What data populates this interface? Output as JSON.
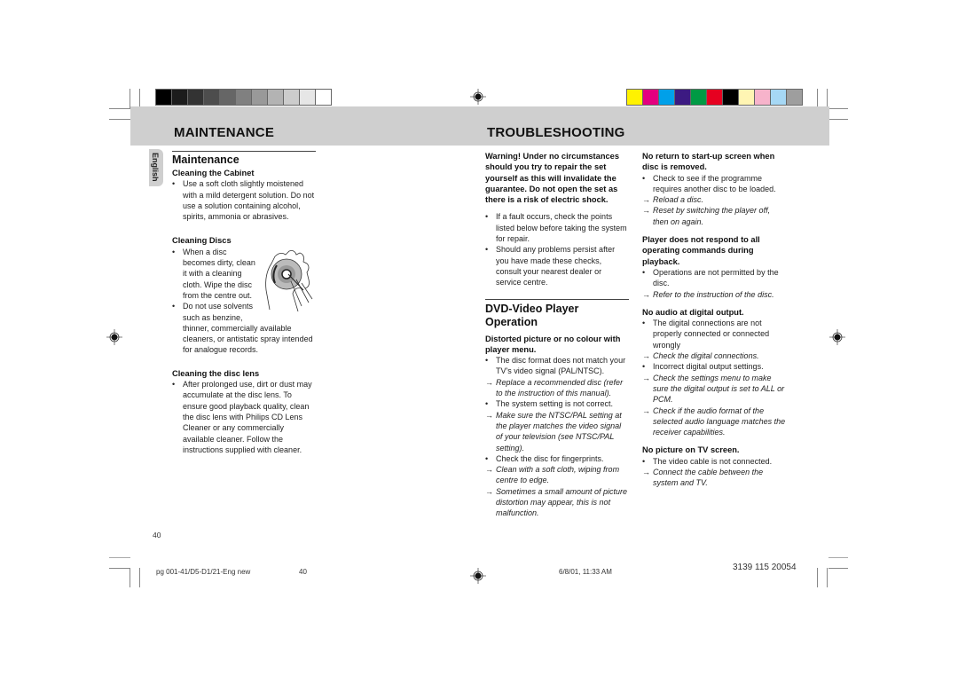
{
  "header": {
    "left_title": "MAINTENANCE",
    "right_title": "TROUBLESHOOTING",
    "gray_swatches": [
      "#000000",
      "#1c1c1c",
      "#333333",
      "#4d4d4d",
      "#666666",
      "#808080",
      "#999999",
      "#b3b3b3",
      "#cccccc",
      "#e6e6e6",
      "#ffffff"
    ],
    "color_swatches": [
      "#fff200",
      "#e4007f",
      "#00a0e9",
      "#3c1a82",
      "#009a44",
      "#e60020",
      "#000000",
      "#fff5b3",
      "#f7b3cb",
      "#a6d8f5",
      "#9e9e9e"
    ]
  },
  "side_tab": {
    "label": "English"
  },
  "maintenance": {
    "heading": "Maintenance",
    "sections": [
      {
        "title": "Cleaning the Cabinet",
        "items": [
          {
            "type": "bullet",
            "text": "Use a soft cloth slightly moistened with a mild detergent solution. Do not use a solution containing alcohol, spirits, ammonia or abrasives."
          }
        ]
      },
      {
        "title": "Cleaning Discs",
        "items": [
          {
            "type": "bullet",
            "text": "When a disc becomes dirty, clean it with a cleaning cloth. Wipe the disc from the centre out."
          },
          {
            "type": "bullet",
            "text": "Do not use solvents such as benzine,"
          }
        ],
        "continuation": "thinner, commercially available cleaners, or antistatic spray intended for analogue records."
      },
      {
        "title": "Cleaning the disc lens",
        "items": [
          {
            "type": "bullet",
            "text": "After prolonged use, dirt or dust may accumulate at the disc lens. To ensure good playback quality, clean the disc lens with Philips CD Lens Cleaner or any commercially available cleaner. Follow the instructions supplied with cleaner."
          }
        ]
      }
    ],
    "illustration": "disc-cleaning-hands-icon"
  },
  "troubleshooting": {
    "warning": "Warning!  Under no circumstances should you try to repair the set yourself as this will invalidate the guarantee. Do not open the set as there is a risk of electric shock.",
    "intro_items": [
      {
        "type": "bullet",
        "text": "If a fault occurs, check the points listed below before taking the system for repair."
      },
      {
        "type": "bullet",
        "text": "Should any problems persist after you have made these checks, consult your nearest dealer or service centre."
      }
    ],
    "dvd_heading": "DVD-Video Player Operation",
    "problems_col1": [
      {
        "title": "Distorted picture or no colour with player menu.",
        "items": [
          {
            "type": "bullet",
            "text": "The disc format does not match your TV's video signal (PAL/NTSC)."
          },
          {
            "type": "action",
            "text": "Replace a recommended disc (refer to the instruction of this manual)."
          },
          {
            "type": "bullet",
            "text": "The system setting is not correct."
          },
          {
            "type": "action",
            "text": "Make sure the NTSC/PAL setting at the player matches the video signal of your television (see NTSC/PAL setting)."
          },
          {
            "type": "bullet",
            "text": "Check the disc for fingerprints."
          },
          {
            "type": "action",
            "text": "Clean with a soft cloth, wiping from centre to edge."
          },
          {
            "type": "action",
            "text": "Sometimes a small amount of picture distortion may appear, this is not malfunction."
          }
        ]
      }
    ],
    "problems_col2": [
      {
        "title": "No return to start-up screen when disc is removed.",
        "items": [
          {
            "type": "bullet",
            "text": "Check to see if the programme requires another disc to be loaded."
          },
          {
            "type": "action",
            "text": "Reload a disc."
          },
          {
            "type": "action",
            "text": "Reset by switching the player off, then on again."
          }
        ]
      },
      {
        "title": "Player does not respond to all operating commands during playback.",
        "items": [
          {
            "type": "bullet",
            "text": "Operations are not permitted by the disc."
          },
          {
            "type": "action",
            "text": "Refer to the instruction of the disc."
          }
        ]
      },
      {
        "title": "No audio at digital output.",
        "items": [
          {
            "type": "bullet",
            "text": "The digital connections are not properly connected or connected wrongly"
          },
          {
            "type": "action",
            "text": "Check the digital connections."
          },
          {
            "type": "bullet",
            "text": "Incorrect digital output settings."
          },
          {
            "type": "action",
            "text": "Check the settings menu to make sure the digital output is set to ALL or PCM."
          },
          {
            "type": "action",
            "text": "Check if the audio format of the selected audio language matches the receiver capabilities."
          }
        ]
      },
      {
        "title": "No picture on TV screen.",
        "items": [
          {
            "type": "bullet",
            "text": "The video cable is not connected."
          },
          {
            "type": "action",
            "text": "Connect the cable between the system and TV."
          }
        ]
      }
    ]
  },
  "markers": {
    "bullet": "•",
    "action": "→"
  },
  "footer": {
    "page_number": "40",
    "file_name": "pg 001-41/D5-D1/21-Eng new",
    "file_page": "40",
    "timestamp": "6/8/01, 11:33 AM",
    "catalog_number": "3139 115 20054"
  }
}
